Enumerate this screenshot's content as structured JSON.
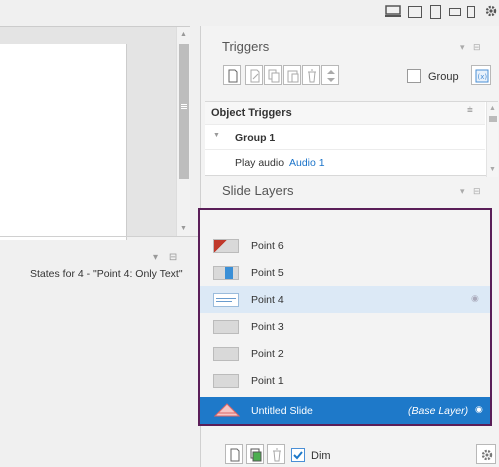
{
  "device_bar": {
    "icons": [
      "desktop-icon",
      "tablet-landscape-icon",
      "tablet-portrait-icon",
      "phone-landscape-icon",
      "phone-portrait-icon",
      "gear-icon"
    ]
  },
  "states_panel": {
    "title": "States for 4 - \"Point 4: Only Text\""
  },
  "triggers": {
    "title": "Triggers",
    "group_label": "Group",
    "toolbar_icons": [
      "new-trigger-icon",
      "edit-trigger-icon",
      "copy-icon",
      "paste-icon",
      "delete-icon",
      "move-up-down-icon"
    ],
    "variables_icon": "variables-icon"
  },
  "object_triggers": {
    "title": "Object Triggers",
    "group_name": "Group 1",
    "trigger_prefix": "Play audio",
    "trigger_target": "Audio 1"
  },
  "slide_layers": {
    "title": "Slide Layers",
    "layers": [
      {
        "label": "Point 6"
      },
      {
        "label": "Point 5"
      },
      {
        "label": "Point 4",
        "selected": true
      },
      {
        "label": "Point 3"
      },
      {
        "label": "Point 2"
      },
      {
        "label": "Point 1"
      }
    ],
    "base": {
      "label": "Untitled Slide",
      "tag": "(Base Layer)"
    }
  },
  "bottom_bar": {
    "dim_label": "Dim",
    "dim_checked": true
  },
  "colors": {
    "accent": "#1e79c9",
    "selected_row": "#dce9f6",
    "highlight_border": "#5a1e58",
    "link": "#1a73c9"
  }
}
